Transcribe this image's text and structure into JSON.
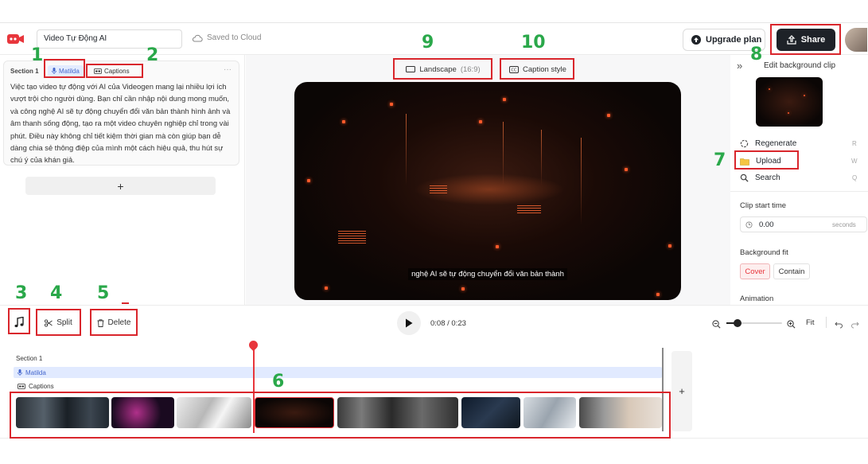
{
  "header": {
    "project_title": "Video Tự Động AI",
    "save_status": "Saved to Cloud",
    "upgrade_label": "Upgrade plan",
    "share_label": "Share"
  },
  "section_panel": {
    "section_label": "Section 1",
    "voice_label": "Matilda",
    "captions_label": "Captions",
    "more": "···",
    "script_text": "Việc tạo video tự động với AI của Videogen mang lại nhiều lợi ích vượt trội cho người dùng. Bạn chỉ cần nhập nội dung mong muốn, và công nghệ AI sẽ tự động chuyển đổi văn bản thành hình ảnh và âm thanh sống động, tạo ra một video chuyên nghiệp chỉ trong vài phút. Điều này không chỉ tiết kiệm thời gian mà còn giúp bạn dễ dàng chia sẻ thông điệp của mình một cách hiệu quả, thu hút sự chú ý của khán giả.",
    "add_label": "+"
  },
  "preview": {
    "landscape_label": "Landscape",
    "landscape_ratio": "(16:9)",
    "caption_style_label": "Caption style",
    "subtitle": "nghệ AI sẽ tự động chuyển đổi văn bản thành"
  },
  "right_panel": {
    "collapse": "»",
    "title": "Edit background clip",
    "regenerate_label": "Regenerate",
    "regenerate_hint": "R",
    "upload_label": "Upload",
    "upload_hint": "W",
    "search_label": "Search",
    "search_hint": "Q",
    "clip_start_label": "Clip start time",
    "clip_start_value": "0.00",
    "clip_start_unit": "seconds",
    "bg_fit_label": "Background fit",
    "cover_label": "Cover",
    "contain_label": "Contain",
    "animation_label": "Animation"
  },
  "toolbar": {
    "split_label": "Split",
    "delete_label": "Delete",
    "time_current": "0:08",
    "time_sep": " / ",
    "time_total": "0:23",
    "fit_label": "Fit",
    "zoom_level": 0.2
  },
  "timeline": {
    "section_label": "Section 1",
    "voice_label": "Matilda",
    "captions_label": "Captions",
    "add_label": "+"
  },
  "annotations": [
    "1",
    "2",
    "3",
    "4",
    "5",
    "6",
    "7",
    "8",
    "9",
    "10"
  ],
  "colors": {
    "accent_red": "#d9262c",
    "annotation_green": "#2aa84a",
    "brand_red": "#e8363c",
    "share_bg": "#1e2228",
    "cover_red": "#e8363c"
  }
}
